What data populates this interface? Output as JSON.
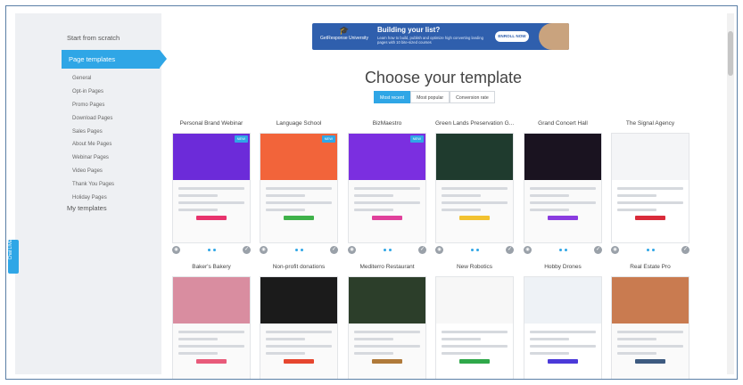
{
  "sidebar": {
    "start_from_scratch": "Start from scratch",
    "page_templates": "Page templates",
    "categories": [
      "General",
      "Opt-in Pages",
      "Promo Pages",
      "Download Pages",
      "Sales Pages",
      "About Me Pages",
      "Webinar Pages",
      "Video Pages",
      "Thank You Pages",
      "Holiday Pages"
    ],
    "my_templates": "My templates",
    "chat_label": "Chat LIVE"
  },
  "banner": {
    "logo_text": "GetResponse University",
    "title": "Building your list?",
    "subtitle": "Learn how to build, publish and optimize high converting landing pages with 10 bite-sized courses",
    "cta": "ENROLL NOW"
  },
  "heading": "Choose your template",
  "sort_tabs": [
    "Most recent",
    "Most popular",
    "Conversion rate"
  ],
  "templates_row1": [
    {
      "name": "Personal Brand Webinar",
      "badge": "NEW",
      "hero": "#6c2bd9",
      "accent": "#e8336d"
    },
    {
      "name": "Language School",
      "badge": "NEW",
      "hero": "#f2643a",
      "accent": "#3fb24a"
    },
    {
      "name": "BizMaestro",
      "badge": "NEW",
      "hero": "#7b2fe0",
      "accent": "#e0409b"
    },
    {
      "name": "Green Lands Preservation G...",
      "badge": "",
      "hero": "#1f3b2e",
      "accent": "#f2c230"
    },
    {
      "name": "Grand Concert Hall",
      "badge": "",
      "hero": "#1a1320",
      "accent": "#8a3ce0"
    },
    {
      "name": "The Signal Agency",
      "badge": "",
      "hero": "#f4f5f7",
      "accent": "#d92b3a"
    }
  ],
  "templates_row2": [
    {
      "name": "Baker's Bakery",
      "hero": "#d98da0",
      "accent": "#e85a7a"
    },
    {
      "name": "Non-profit donations",
      "hero": "#1b1b1b",
      "accent": "#e6462f"
    },
    {
      "name": "Mediterro Restaurant",
      "hero": "#2c3e2a",
      "accent": "#b07a3a"
    },
    {
      "name": "New Robotics",
      "hero": "#f7f7f7",
      "accent": "#2fa84a"
    },
    {
      "name": "Hobby Drones",
      "hero": "#eef2f6",
      "accent": "#4b3ad9"
    },
    {
      "name": "Real Estate Pro",
      "hero": "#c97b50",
      "accent": "#3d5a80"
    }
  ]
}
